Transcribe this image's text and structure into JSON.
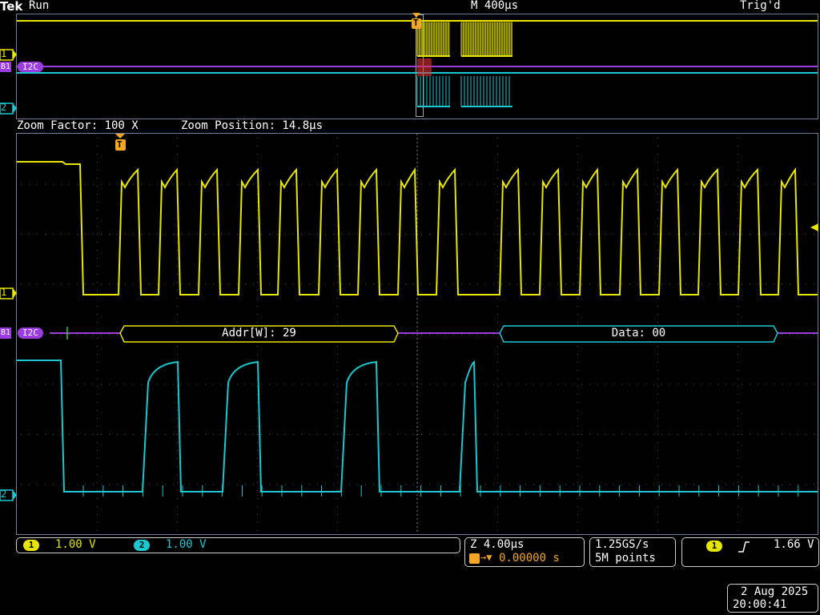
{
  "header": {
    "brand": "Tek",
    "run_state": "Run",
    "main_timebase": "M 400µs",
    "trigger_state": "Trig'd",
    "trigger_marker": "T"
  },
  "zoom": {
    "factor_label": "Zoom Factor: 100 X",
    "position_label": "Zoom Position: 14.8µs"
  },
  "channels": [
    {
      "id": "1",
      "scale": "1.00 V",
      "color": "#e6e600"
    },
    {
      "id": "2",
      "scale": "1.00 V",
      "color": "#19c9d2"
    }
  ],
  "bus": {
    "id": "B1",
    "protocol": "I2C",
    "color": "#9b3be0",
    "packets": [
      {
        "label": "Addr[W]: 29",
        "color": "#e6e600"
      },
      {
        "label": "Data: 00",
        "color": "#19c9d2"
      }
    ]
  },
  "bottom": {
    "zoom_timebase": "Z 4.00µs",
    "trigger_position": "0.00000 s",
    "sample_rate": "1.25GS/s",
    "record_length": "5M points",
    "trigger_channel": "1",
    "trigger_level": "1.66 V",
    "date": "2 Aug 2025",
    "time": "20:00:41"
  }
}
